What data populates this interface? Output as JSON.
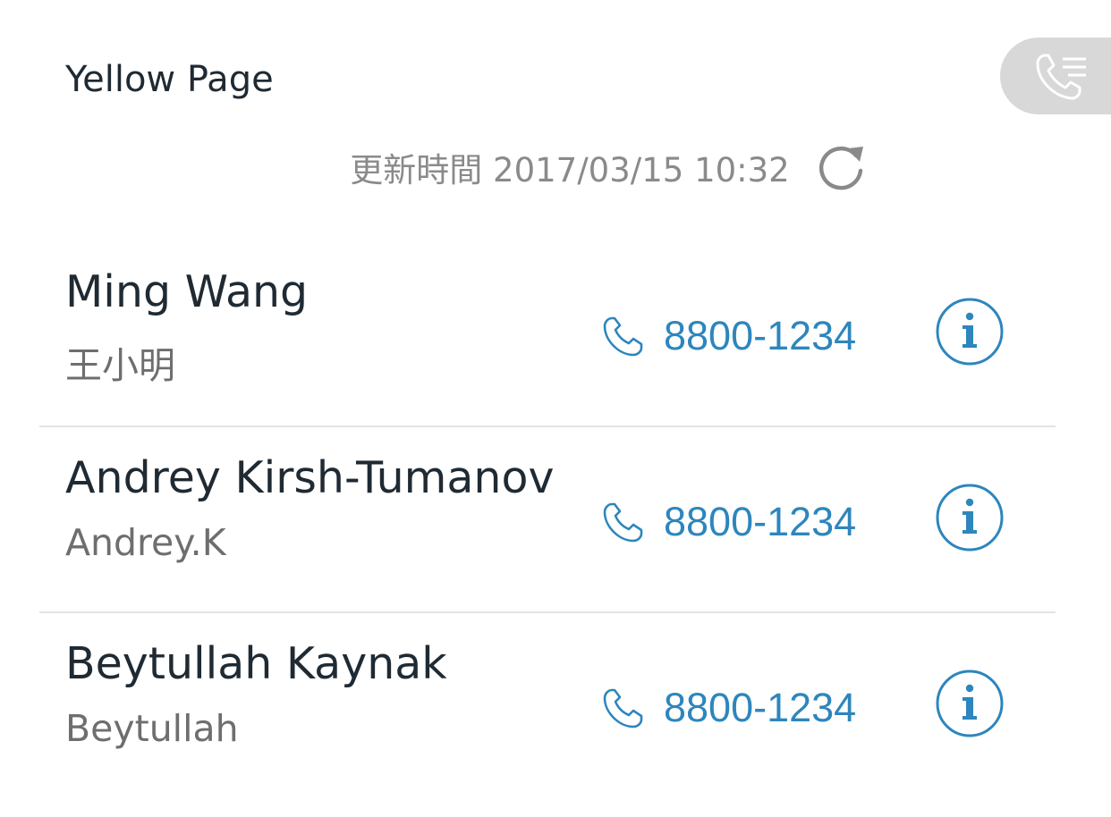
{
  "header": {
    "title": "Yellow Page",
    "call_log_icon": "phone-list-icon"
  },
  "update": {
    "text": "更新時間 2017/03/15 10:32",
    "refresh_icon": "refresh-icon"
  },
  "colors": {
    "accent": "#2d86bd",
    "title_text": "#1f2a33",
    "muted_text": "#8a8a8a",
    "alias_text": "#6e6e6e",
    "divider": "#e3e3e3",
    "tab_bg": "#d8d8d8"
  },
  "contacts": [
    {
      "name": "Ming Wang",
      "alias": "王小明",
      "phone": "8800-1234",
      "phone_icon": "phone-icon",
      "info_icon": "info-icon"
    },
    {
      "name": "Andrey Kirsh-Tumanov",
      "alias": "Andrey.K",
      "phone": "8800-1234",
      "phone_icon": "phone-icon",
      "info_icon": "info-icon"
    },
    {
      "name": "Beytullah Kaynak",
      "alias": "Beytullah",
      "phone": "8800-1234",
      "phone_icon": "phone-icon",
      "info_icon": "info-icon"
    }
  ]
}
